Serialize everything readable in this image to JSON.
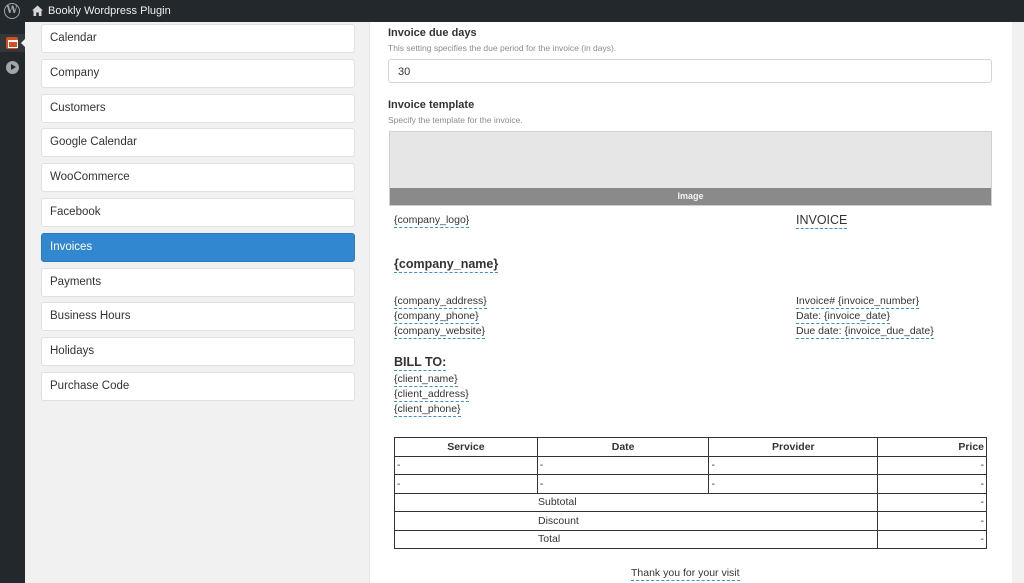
{
  "topbar": {
    "site_name": "Bookly Wordpress Plugin",
    "wp_logo": "W"
  },
  "nav": {
    "items": [
      {
        "label": "Calendar"
      },
      {
        "label": "Company"
      },
      {
        "label": "Customers"
      },
      {
        "label": "Google Calendar"
      },
      {
        "label": "WooCommerce"
      },
      {
        "label": "Facebook"
      },
      {
        "label": "Invoices",
        "active": true
      },
      {
        "label": "Payments"
      },
      {
        "label": "Business Hours"
      },
      {
        "label": "Holidays"
      },
      {
        "label": "Purchase Code"
      }
    ]
  },
  "due_days": {
    "label": "Invoice due days",
    "help": "This setting specifies the due period for the invoice (in days).",
    "value": "30"
  },
  "template": {
    "label": "Invoice template",
    "help": "Specify the template for the invoice.",
    "editor_bar": "Image",
    "company_logo": "{company_logo}",
    "invoice_title": "INVOICE",
    "company_name": "{company_name}",
    "company_address": "{company_address}",
    "company_phone": "{company_phone}",
    "company_website": "{company_website}",
    "invoice_number": "Invoice# {invoice_number}",
    "invoice_date": "Date: {invoice_date}",
    "invoice_due_date": "Due date: {invoice_due_date}",
    "bill_to": "BILL TO:",
    "client_name": "{client_name}",
    "client_address": "{client_address}",
    "client_phone": "{client_phone}",
    "table": {
      "headers": [
        "Service",
        "Date",
        "Provider",
        "Price"
      ],
      "rows": [
        [
          "-",
          "-",
          "-",
          "-"
        ],
        [
          "-",
          "-",
          "-",
          "-"
        ]
      ],
      "summary": [
        {
          "label": "Subtotal",
          "value": "-"
        },
        {
          "label": "Discount",
          "value": "-"
        },
        {
          "label": "Total",
          "value": "-"
        }
      ]
    },
    "thanks": "Thank you for your visit"
  },
  "colors": {
    "accent": "#3188d0",
    "adminbar": "#23282d",
    "placeholder_underline": "#3d8fd1"
  }
}
